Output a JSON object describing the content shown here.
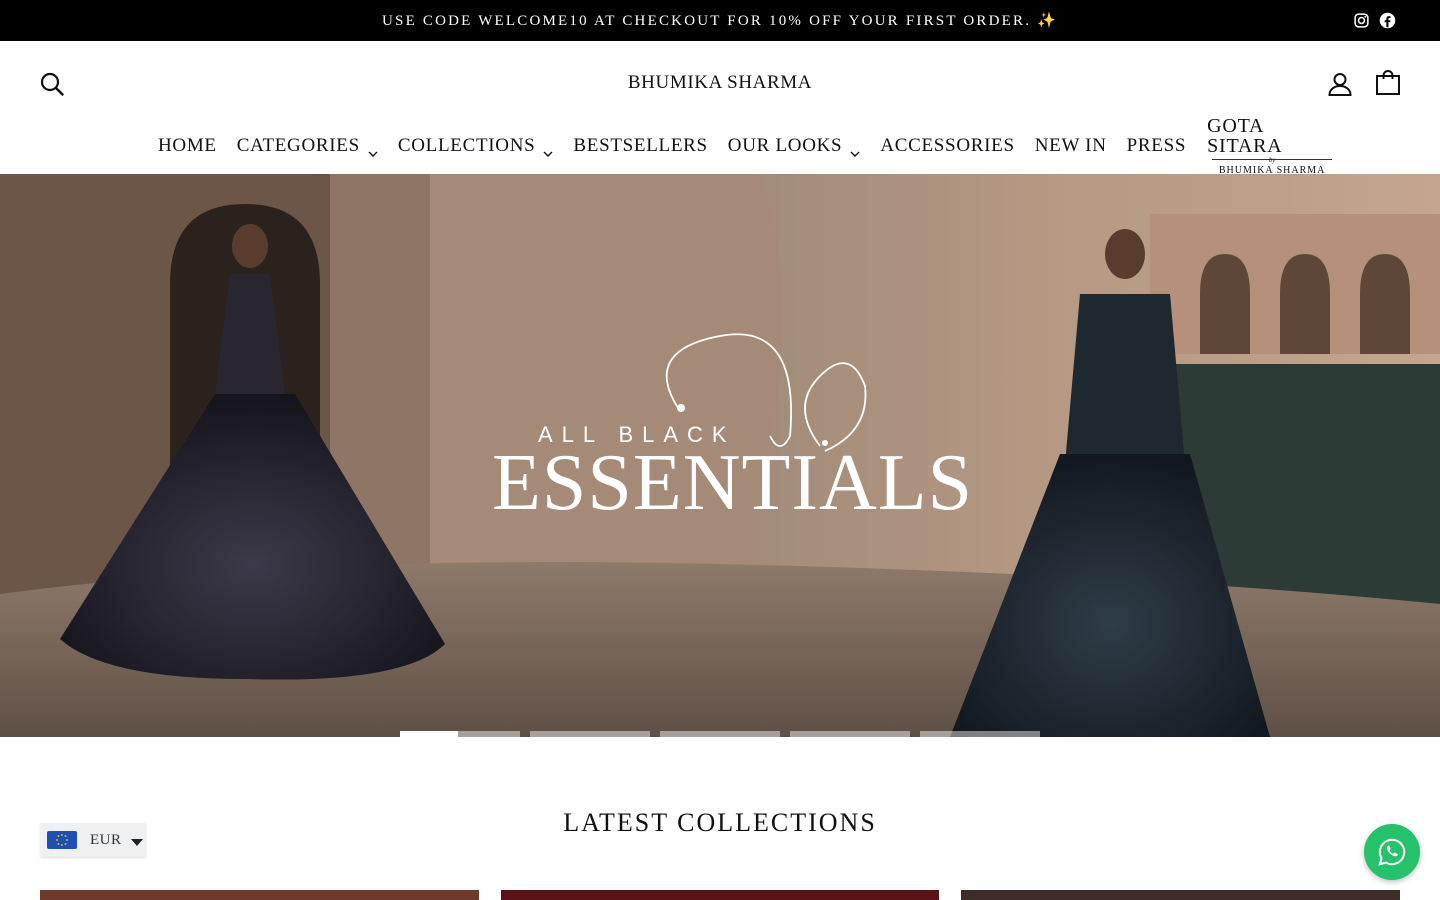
{
  "announcement": {
    "text": "USE CODE WELCOME10 AT CHECKOUT FOR 10% OFF YOUR FIRST ORDER. ✨",
    "social_icons": [
      "instagram-icon",
      "facebook-icon"
    ]
  },
  "header": {
    "brand": "BHUMIKA SHARMA",
    "icons": [
      "search-icon",
      "account-icon",
      "cart-icon"
    ]
  },
  "nav": {
    "items": [
      {
        "label": "HOME",
        "dropdown": false
      },
      {
        "label": "CATEGORIES",
        "dropdown": true
      },
      {
        "label": "COLLECTIONS",
        "dropdown": true
      },
      {
        "label": "BESTSELLERS",
        "dropdown": false
      },
      {
        "label": "OUR LOOKS",
        "dropdown": true
      },
      {
        "label": "ACCESSORIES",
        "dropdown": false
      },
      {
        "label": "NEW IN",
        "dropdown": false
      },
      {
        "label": "PRESS",
        "dropdown": false
      }
    ],
    "gota_logo": {
      "main": "GOTA SITARA",
      "by": "by",
      "sub": "BHUMIKA SHARMA"
    }
  },
  "hero": {
    "line1": "ALL BLACK",
    "line2": "ESSENTIALS",
    "slides_count": 5,
    "active_slide": 1,
    "active_progress": 0.48
  },
  "latest": {
    "title": "LATEST COLLECTIONS"
  },
  "currency": {
    "code": "EUR",
    "flag_icon": "eu-flag-icon"
  },
  "chat": {
    "icon": "whatsapp-icon"
  },
  "colors": {
    "announce_bg": "#000000",
    "whatsapp_green": "#25c16b",
    "currency_bg": "#eef0f2"
  }
}
